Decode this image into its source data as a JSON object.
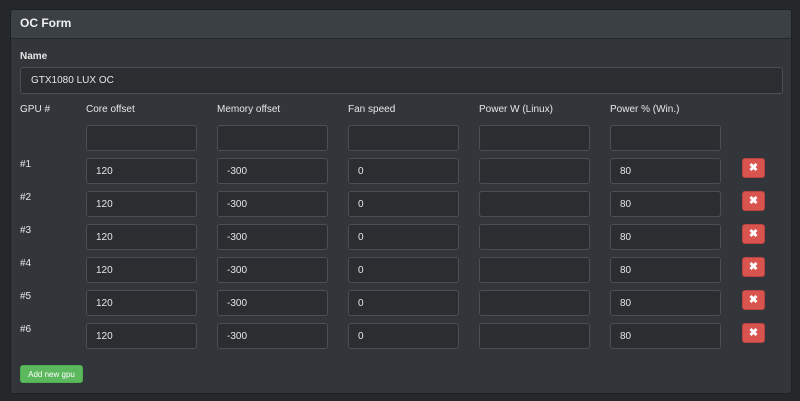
{
  "panel": {
    "title": "OC Form"
  },
  "form": {
    "name_label": "Name",
    "name_value": "GTX1080 LUX OC",
    "columns": [
      "GPU #",
      "Core offset",
      "Memory offset",
      "Fan speed",
      "Power W (Linux)",
      "Power % (Win.)"
    ],
    "header_inputs": [
      "",
      "",
      "",
      "",
      ""
    ],
    "rows": [
      {
        "label": "#1",
        "core": "120",
        "memory": "-300",
        "fan": "0",
        "power_w": "",
        "power_pct": "80"
      },
      {
        "label": "#2",
        "core": "120",
        "memory": "-300",
        "fan": "0",
        "power_w": "",
        "power_pct": "80"
      },
      {
        "label": "#3",
        "core": "120",
        "memory": "-300",
        "fan": "0",
        "power_w": "",
        "power_pct": "80"
      },
      {
        "label": "#4",
        "core": "120",
        "memory": "-300",
        "fan": "0",
        "power_w": "",
        "power_pct": "80"
      },
      {
        "label": "#5",
        "core": "120",
        "memory": "-300",
        "fan": "0",
        "power_w": "",
        "power_pct": "80"
      },
      {
        "label": "#6",
        "core": "120",
        "memory": "-300",
        "fan": "0",
        "power_w": "",
        "power_pct": "80"
      }
    ],
    "delete_icon": "close-icon",
    "delete_glyph": "✖",
    "add_button_label": "Add new gpu"
  },
  "colors": {
    "page_bg": "#25282b",
    "panel_bg": "#32363a",
    "header_bg": "#3b4045",
    "input_bg": "#2b2e31",
    "input_border": "#4a4f55",
    "danger": "#d9534f",
    "success": "#5cb85c"
  }
}
